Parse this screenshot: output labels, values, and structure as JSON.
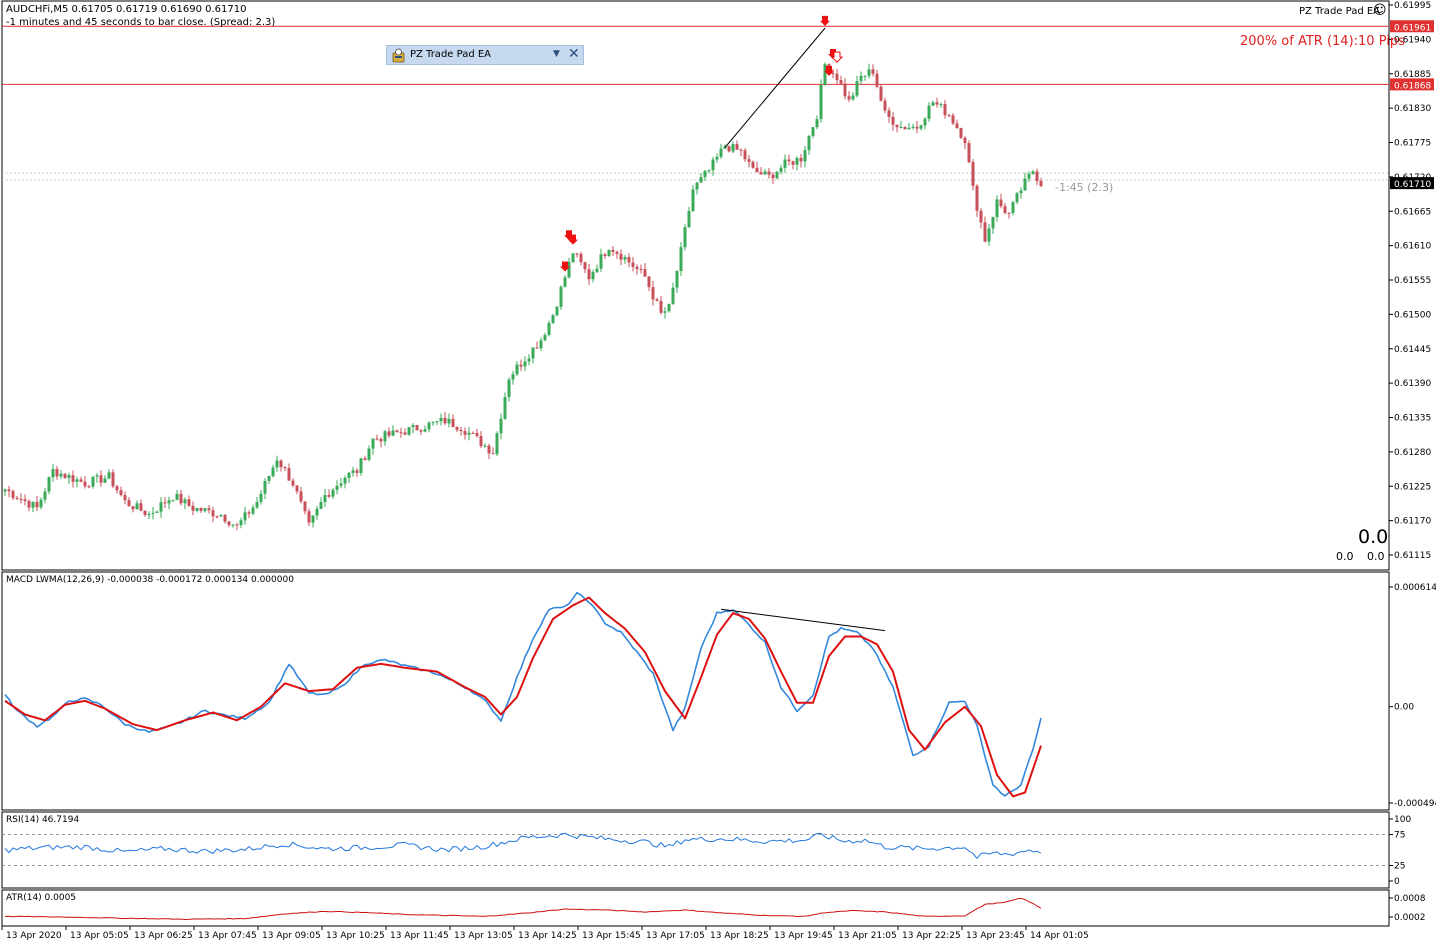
{
  "header": {
    "symbol_line": "AUDCHFi,M5  0.61705 0.61719 0.61690 0.61710",
    "timer_line": "-1 minutes and 45 seconds to bar close. (Spread: 2.3)",
    "ea_name": "PZ Trade Pad EA",
    "atr_note": "200% of ATR (14):10 Pips",
    "countdown": "-1:45 (2.3)",
    "big_zero": "0.0",
    "small_zero_left": "0.0",
    "small_zero_right": "0.0"
  },
  "panel": {
    "title": "PZ Trade Pad EA",
    "dropdown_glyph": "▼",
    "close_glyph": "✕"
  },
  "colors": {
    "bull": "#3aaa5a",
    "bear": "#c8505a",
    "level_line": "#e03030",
    "macd_line": "#3388dd",
    "signal_line": "#dd1111",
    "rsi_line": "#2277dd",
    "atr_line": "#cc1111"
  },
  "price_axis": {
    "labels": [
      "0.61995",
      "0.61940",
      "0.61885",
      "0.61830",
      "0.61775",
      "0.61720",
      "0.61665",
      "0.61610",
      "0.61555",
      "0.61500",
      "0.61445",
      "0.61390",
      "0.61335",
      "0.61280",
      "0.61225",
      "0.61170",
      "0.61115"
    ],
    "level_upper": "0.61961",
    "level_lower": "0.61868",
    "current_price": "0.61710"
  },
  "macd": {
    "label": "MACD LWMA(12,26,9) -0.000038 -0.000172 0.000134 0.000000",
    "axis_top": "0.000614",
    "axis_mid": "0.00",
    "axis_bottom": "-0.000494"
  },
  "rsi": {
    "label": "RSI(14) 46.7194",
    "axis": [
      "100",
      "75",
      "25",
      "0"
    ]
  },
  "atr": {
    "label": "ATR(14) 0.0005",
    "axis": [
      "0.0008",
      "0.0002"
    ]
  },
  "time_axis": [
    "13 Apr 2020",
    "13 Apr 05:05",
    "13 Apr 06:25",
    "13 Apr 07:45",
    "13 Apr 09:05",
    "13 Apr 10:25",
    "13 Apr 11:45",
    "13 Apr 13:05",
    "13 Apr 14:25",
    "13 Apr 15:45",
    "13 Apr 17:05",
    "13 Apr 18:25",
    "13 Apr 19:45",
    "13 Apr 21:05",
    "13 Apr 22:25",
    "13 Apr 23:45",
    "14 Apr 01:05"
  ],
  "chart_data": {
    "type": "candlestick",
    "symbol": "AUDCHFi",
    "timeframe": "M5",
    "ylim": [
      0.61115,
      0.61995
    ],
    "close_anchors": [
      [
        0,
        0.6122
      ],
      [
        8,
        0.6119
      ],
      [
        12,
        0.6125
      ],
      [
        20,
        0.6123
      ],
      [
        26,
        0.6124
      ],
      [
        30,
        0.612
      ],
      [
        36,
        0.6118
      ],
      [
        42,
        0.6121
      ],
      [
        47,
        0.6119
      ],
      [
        54,
        0.6118
      ],
      [
        58,
        0.6116
      ],
      [
        63,
        0.612
      ],
      [
        68,
        0.6127
      ],
      [
        72,
        0.6123
      ],
      [
        76,
        0.6116
      ],
      [
        80,
        0.6121
      ],
      [
        85,
        0.6124
      ],
      [
        88,
        0.6125
      ],
      [
        92,
        0.613
      ],
      [
        98,
        0.6131
      ],
      [
        104,
        0.6132
      ],
      [
        110,
        0.6133
      ],
      [
        114,
        0.6132
      ],
      [
        118,
        0.613
      ],
      [
        122,
        0.6128
      ],
      [
        126,
        0.614
      ],
      [
        130,
        0.6143
      ],
      [
        134,
        0.6146
      ],
      [
        137,
        0.615
      ],
      [
        140,
        0.6156
      ],
      [
        142,
        0.616
      ],
      [
        146,
        0.6156
      ],
      [
        151,
        0.6161
      ],
      [
        155,
        0.6159
      ],
      [
        160,
        0.6156
      ],
      [
        164,
        0.615
      ],
      [
        166,
        0.6151
      ],
      [
        169,
        0.616
      ],
      [
        172,
        0.617
      ],
      [
        176,
        0.6173
      ],
      [
        180,
        0.6177
      ],
      [
        184,
        0.6176
      ],
      [
        187,
        0.6173
      ],
      [
        191,
        0.6172
      ],
      [
        195,
        0.6174
      ],
      [
        199,
        0.6175
      ],
      [
        203,
        0.6182
      ],
      [
        205,
        0.619
      ],
      [
        208,
        0.6188
      ],
      [
        211,
        0.6184
      ],
      [
        214,
        0.6188
      ],
      [
        217,
        0.6189
      ],
      [
        220,
        0.6182
      ],
      [
        224,
        0.618
      ],
      [
        228,
        0.618
      ],
      [
        232,
        0.6184
      ],
      [
        236,
        0.6182
      ],
      [
        240,
        0.6178
      ],
      [
        242,
        0.617
      ],
      [
        245,
        0.6162
      ],
      [
        248,
        0.6168
      ],
      [
        251,
        0.6166
      ],
      [
        254,
        0.617
      ],
      [
        257,
        0.6173
      ],
      [
        259,
        0.6171
      ]
    ],
    "down_arrows": [
      [
        140,
        0.61575
      ],
      [
        141,
        0.61625
      ],
      [
        142,
        0.61618
      ],
      [
        205,
        0.61968
      ],
      [
        206,
        0.61888
      ],
      [
        207,
        0.61915
      ]
    ],
    "hollow_arrow": [
      208,
      0.6191
    ],
    "trendline_price": [
      [
        180,
        0.61767
      ],
      [
        205,
        0.61958
      ]
    ],
    "level_upper": 0.61961,
    "level_lower": 0.61868,
    "current": 0.6171,
    "macd_range": [
      -0.000494,
      0.000614
    ],
    "macd_anchors": [
      [
        0,
        6e-05
      ],
      [
        3,
        -2e-05
      ],
      [
        8,
        -0.0001
      ],
      [
        12,
        -5e-05
      ],
      [
        16,
        3e-05
      ],
      [
        20,
        4e-05
      ],
      [
        24,
        1e-05
      ],
      [
        30,
        -9e-05
      ],
      [
        36,
        -0.00013
      ],
      [
        40,
        -0.00011
      ],
      [
        44,
        -8e-05
      ],
      [
        50,
        -2e-05
      ],
      [
        54,
        -4e-05
      ],
      [
        60,
        -6e-05
      ],
      [
        66,
        2e-05
      ],
      [
        71,
        0.00022
      ],
      [
        76,
        7e-05
      ],
      [
        80,
        6e-05
      ],
      [
        84,
        0.0001
      ],
      [
        90,
        0.00022
      ],
      [
        95,
        0.00024
      ],
      [
        100,
        0.00021
      ],
      [
        108,
        0.00017
      ],
      [
        116,
        9e-05
      ],
      [
        120,
        3e-05
      ],
      [
        124,
        -7e-05
      ],
      [
        128,
        0.00015
      ],
      [
        132,
        0.00035
      ],
      [
        136,
        0.0005
      ],
      [
        140,
        0.00051
      ],
      [
        143,
        0.00058
      ],
      [
        146,
        0.00054
      ],
      [
        150,
        0.00043
      ],
      [
        154,
        0.00038
      ],
      [
        158,
        0.00028
      ],
      [
        162,
        0.00017
      ],
      [
        167,
        -0.00012
      ],
      [
        170,
        -1e-05
      ],
      [
        174,
        0.0003
      ],
      [
        178,
        0.00048
      ],
      [
        182,
        0.0005
      ],
      [
        186,
        0.00042
      ],
      [
        190,
        0.00033
      ],
      [
        194,
        0.0001
      ],
      [
        198,
        -2e-05
      ],
      [
        202,
        6e-05
      ],
      [
        206,
        0.00036
      ],
      [
        209,
        0.0004
      ],
      [
        213,
        0.00038
      ],
      [
        217,
        0.0003
      ],
      [
        222,
        0.0001
      ],
      [
        227,
        -0.00025
      ],
      [
        231,
        -0.0002
      ],
      [
        236,
        2e-05
      ],
      [
        240,
        3e-05
      ],
      [
        243,
        -0.0001
      ],
      [
        247,
        -0.0004
      ],
      [
        250,
        -0.00046
      ],
      [
        254,
        -0.0004
      ],
      [
        257,
        -0.00022
      ],
      [
        259,
        -6e-05
      ]
    ],
    "macd_signal_anchors": [
      [
        0,
        3e-05
      ],
      [
        5,
        -4e-05
      ],
      [
        10,
        -7e-05
      ],
      [
        15,
        1e-05
      ],
      [
        20,
        3e-05
      ],
      [
        25,
        -1e-05
      ],
      [
        32,
        -9e-05
      ],
      [
        38,
        -0.00012
      ],
      [
        45,
        -7e-05
      ],
      [
        52,
        -3e-05
      ],
      [
        58,
        -7e-05
      ],
      [
        64,
        0.0
      ],
      [
        70,
        0.00012
      ],
      [
        76,
        8e-05
      ],
      [
        82,
        9e-05
      ],
      [
        88,
        0.0002
      ],
      [
        94,
        0.00022
      ],
      [
        100,
        0.0002
      ],
      [
        108,
        0.00018
      ],
      [
        115,
        0.0001
      ],
      [
        120,
        5e-05
      ],
      [
        124,
        -4e-05
      ],
      [
        128,
        5e-05
      ],
      [
        132,
        0.00025
      ],
      [
        137,
        0.00045
      ],
      [
        142,
        0.00052
      ],
      [
        146,
        0.00056
      ],
      [
        150,
        0.00048
      ],
      [
        155,
        0.0004
      ],
      [
        160,
        0.00028
      ],
      [
        165,
        8e-05
      ],
      [
        170,
        -6e-05
      ],
      [
        174,
        0.00015
      ],
      [
        178,
        0.00037
      ],
      [
        182,
        0.00048
      ],
      [
        186,
        0.00045
      ],
      [
        190,
        0.00035
      ],
      [
        194,
        0.00018
      ],
      [
        198,
        2e-05
      ],
      [
        202,
        2e-05
      ],
      [
        206,
        0.00026
      ],
      [
        210,
        0.00036
      ],
      [
        214,
        0.00036
      ],
      [
        218,
        0.00032
      ],
      [
        222,
        0.00018
      ],
      [
        226,
        -0.00012
      ],
      [
        230,
        -0.00022
      ],
      [
        235,
        -8e-05
      ],
      [
        240,
        0.0
      ],
      [
        244,
        -0.0001
      ],
      [
        248,
        -0.00035
      ],
      [
        252,
        -0.00046
      ],
      [
        255,
        -0.00044
      ],
      [
        259,
        -0.0002
      ]
    ],
    "macd_trendline": [
      [
        179,
        0.0005
      ],
      [
        220,
        0.00039
      ]
    ],
    "rsi_anchors": [
      [
        0,
        50
      ],
      [
        10,
        54
      ],
      [
        20,
        55
      ],
      [
        30,
        47
      ],
      [
        40,
        52
      ],
      [
        50,
        48
      ],
      [
        60,
        51
      ],
      [
        70,
        60
      ],
      [
        80,
        52
      ],
      [
        90,
        54
      ],
      [
        100,
        58
      ],
      [
        110,
        50
      ],
      [
        120,
        56
      ],
      [
        130,
        70
      ],
      [
        140,
        75
      ],
      [
        150,
        68
      ],
      [
        160,
        63
      ],
      [
        166,
        55
      ],
      [
        170,
        67
      ],
      [
        180,
        68
      ],
      [
        190,
        64
      ],
      [
        200,
        66
      ],
      [
        204,
        74
      ],
      [
        210,
        64
      ],
      [
        215,
        66
      ],
      [
        220,
        55
      ],
      [
        230,
        52
      ],
      [
        240,
        55
      ],
      [
        243,
        38
      ],
      [
        247,
        45
      ],
      [
        251,
        43
      ],
      [
        256,
        50
      ],
      [
        259,
        47
      ]
    ],
    "atr_anchors": [
      [
        0,
        0.00022
      ],
      [
        15,
        0.0002
      ],
      [
        30,
        0.00016
      ],
      [
        45,
        0.00013
      ],
      [
        60,
        0.00015
      ],
      [
        70,
        0.0003
      ],
      [
        80,
        0.00038
      ],
      [
        90,
        0.00034
      ],
      [
        100,
        0.00028
      ],
      [
        110,
        0.00025
      ],
      [
        120,
        0.00022
      ],
      [
        130,
        0.00032
      ],
      [
        140,
        0.00045
      ],
      [
        150,
        0.00042
      ],
      [
        160,
        0.00036
      ],
      [
        170,
        0.00042
      ],
      [
        180,
        0.00032
      ],
      [
        190,
        0.00025
      ],
      [
        200,
        0.00022
      ],
      [
        205,
        0.00034
      ],
      [
        212,
        0.0004
      ],
      [
        220,
        0.00036
      ],
      [
        230,
        0.00022
      ],
      [
        240,
        0.00024
      ],
      [
        245,
        0.0006
      ],
      [
        250,
        0.00066
      ],
      [
        254,
        0.0008
      ],
      [
        257,
        0.00062
      ],
      [
        259,
        0.00048
      ]
    ]
  }
}
